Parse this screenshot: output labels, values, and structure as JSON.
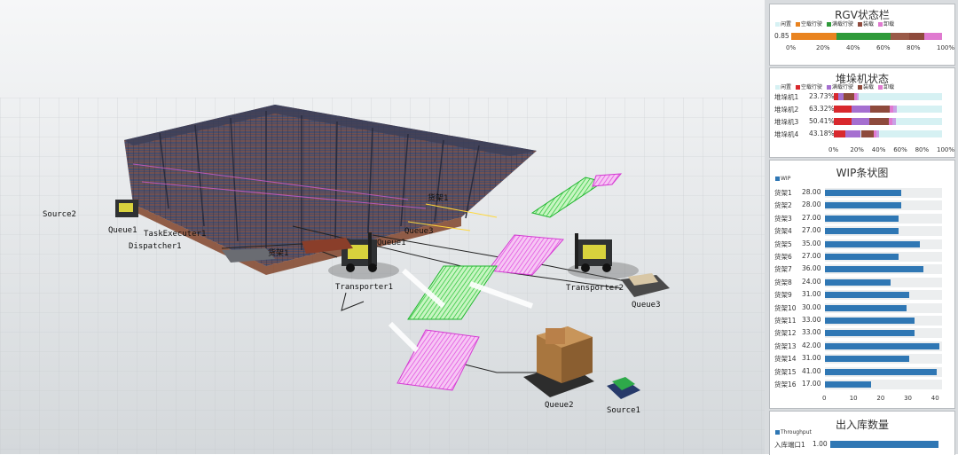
{
  "colors": {
    "idle": "#d6f1f3",
    "empty_travel": "#e9831f",
    "loaded_travel": "#2f9a3a",
    "loading": "#8e4a3c",
    "unloading": "#e07ad0",
    "stacker_empty": "#d8282d",
    "stacker_loaded": "#a56fd0",
    "wip_bar": "#2f77b4"
  },
  "scene": {
    "labels": {
      "source2": "Source2",
      "queue1_a": "Queue1",
      "dispatcher": "Dispatcher1",
      "task_executer": "TaskExecuter1",
      "rack1": "货架1",
      "rack_label_b": "货架1",
      "queue1_b": "Queue1",
      "queue2_center": "Queue2",
      "transporter1": "Transporter1",
      "transporter2": "Transporter2",
      "queue3": "Queue3",
      "queue2": "Queue2",
      "source1": "Source1",
      "queue3_small": "Queue3"
    }
  },
  "rgv_panel": {
    "title": "RGV状态栏",
    "legend": [
      "闲置",
      "空载行驶",
      "满载行驶",
      "装载",
      "卸载"
    ],
    "row_label": "0.85",
    "segments": [
      0.3,
      0.36,
      0.12,
      0.1,
      0.12
    ],
    "ticks": [
      "0%",
      "20%",
      "40%",
      "60%",
      "80%",
      "100%"
    ]
  },
  "stacker_panel": {
    "title": "堆垛机状态",
    "legend": [
      "闲置",
      "空载行驶",
      "满载行驶",
      "装载",
      "卸载"
    ],
    "rows": [
      {
        "name": "堆垛机1",
        "pct": "23.73%",
        "segments": [
          0.04,
          0.05,
          0.1,
          0.02,
          0.02
        ]
      },
      {
        "name": "堆垛机2",
        "pct": "63.32%",
        "segments": [
          0.16,
          0.18,
          0.18,
          0.03,
          0.03
        ]
      },
      {
        "name": "堆垛机3",
        "pct": "50.41%",
        "segments": [
          0.16,
          0.17,
          0.18,
          0.03,
          0.03
        ]
      },
      {
        "name": "堆垛机4",
        "pct": "43.18%",
        "segments": [
          0.11,
          0.14,
          0.12,
          0.02,
          0.03
        ]
      }
    ],
    "ticks": [
      "0%",
      "20%",
      "40%",
      "60%",
      "80%",
      "100%"
    ]
  },
  "wip_panel": {
    "title": "WIP条状图",
    "legend": "WIP",
    "max": 43,
    "ticks": [
      "0",
      "10",
      "20",
      "30",
      "40"
    ]
  },
  "throughput_panel": {
    "title": "出入库数量",
    "legend": "Throughput",
    "rows": [
      {
        "name": "入库端口1",
        "value_text": "1.00",
        "value": 1.0
      }
    ]
  },
  "chart_data": [
    {
      "type": "bar",
      "title": "WIP条状图",
      "orientation": "horizontal",
      "categories": [
        "货架1",
        "货架2",
        "货架3",
        "货架4",
        "货架5",
        "货架6",
        "货架7",
        "货架8",
        "货架9",
        "货架10",
        "货架11",
        "货架12",
        "货架13",
        "货架14",
        "货架15",
        "货架16"
      ],
      "series": [
        {
          "name": "WIP",
          "values": [
            28,
            28,
            27,
            27,
            35,
            27,
            36,
            24,
            31,
            30,
            33,
            33,
            42,
            31,
            41,
            17
          ]
        }
      ],
      "value_labels": [
        "28.00",
        "28.00",
        "27.00",
        "27.00",
        "35.00",
        "27.00",
        "36.00",
        "24.00",
        "31.00",
        "30.00",
        "33.00",
        "33.00",
        "42.00",
        "31.00",
        "41.00",
        "17.00"
      ],
      "xlim": [
        0,
        43
      ]
    }
  ]
}
